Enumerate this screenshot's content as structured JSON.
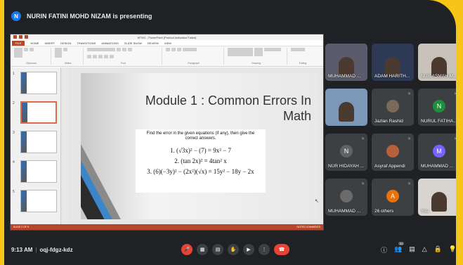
{
  "banner": {
    "presenting_text": "NURIN FATINI MOHD NIZAM is presenting",
    "initial": "N"
  },
  "ppt": {
    "title_bar": "KP101 - PowerPoint (Product Activation Failed)",
    "tabs": [
      "FILE",
      "HOME",
      "INSERT",
      "DESIGN",
      "TRANSITIONS",
      "ANIMATIONS",
      "SLIDE SHOW",
      "REVIEW",
      "VIEW"
    ],
    "ribbon_groups": [
      "Clipboard",
      "Slides",
      "Font",
      "Paragraph",
      "Drawing",
      "Editing"
    ],
    "thumb_numbers": [
      "1",
      "2",
      "3",
      "4",
      "5"
    ],
    "slide": {
      "title_line1": "Module 1 : Common Errors In",
      "title_line2": "Math",
      "instruction": "Find the error in the given equations (if any), then give the correct answers.",
      "eq1": "1. (√3x)² − (7) = 9x² − 7",
      "eq2": "2. (tan 2x)² = 4tan² x",
      "eq3": "3. (6)(−3y)² − (2x²)(√x) = 15y² − 18y − 2x"
    },
    "status_left": "SLIDE 2 OF 5",
    "status_right": "NOTES   COMMENTS"
  },
  "participants": [
    {
      "name": "MUHAMMAD ...",
      "type": "video",
      "bg": "#5b5b6b"
    },
    {
      "name": "ADAM HARITH...",
      "type": "video",
      "bg": "#2e3a55"
    },
    {
      "name": "NUR ASMAH M...",
      "type": "video",
      "bg": "#c9c2bb"
    },
    {
      "name": "",
      "type": "video",
      "bg": "#7b98b8"
    },
    {
      "name": "Jazlan Rashid",
      "type": "avatar-img",
      "initial": "",
      "color": "#7a6a5a"
    },
    {
      "name": "NURUL FATIHA...",
      "type": "avatar",
      "initial": "N",
      "color": "#1e8e3e"
    },
    {
      "name": "NUR HIDAYAH ...",
      "type": "avatar",
      "initial": "N",
      "color": "#5f6368"
    },
    {
      "name": "Asyraf Appendi",
      "type": "avatar-img",
      "initial": "",
      "color": "#b5613a"
    },
    {
      "name": "MUHAMMAD ...",
      "type": "avatar",
      "initial": "M",
      "color": "#7b61ff"
    },
    {
      "name": "MUHAMMAD ...",
      "type": "avatar-img",
      "initial": "",
      "color": "#6b6b6b"
    },
    {
      "name": "26 others",
      "type": "others",
      "initial": "A",
      "color": "#e8710a"
    },
    {
      "name": "You",
      "type": "video",
      "bg": "#d8d4cf"
    }
  ],
  "bottom": {
    "time": "9:13 AM",
    "separator": "|",
    "meeting_code": "oqj-fdgz-kdz",
    "people_count": "31"
  },
  "colors": {
    "accent": "#f5c518",
    "ppt_red": "#b7472a",
    "hangup": "#ea4335"
  }
}
